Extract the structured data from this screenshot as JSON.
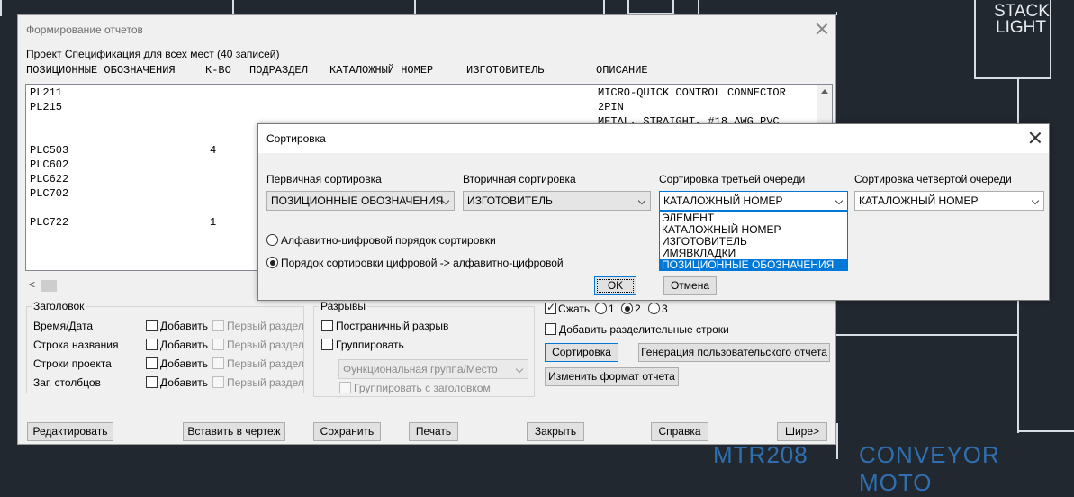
{
  "background": {
    "stack_light_label_line1": "STACK",
    "stack_light_label_line2": "LIGHT",
    "bottom_label_left": "MTR208",
    "bottom_label_right": "CONVEYOR MOTO"
  },
  "report_dialog": {
    "title": "Формирование отчетов",
    "project_label": "Проект Спецификация для всех мест (40 записей)",
    "columns": [
      "ПОЗИЦИОННЫЕ ОБОЗНАЧЕНИЯ",
      "К-ВО",
      "ПОДРАЗДЕЛ",
      "КАТАЛОЖНЫЙ НОМЕР",
      "ИЗГОТОВИТЕЛЬ",
      "ОПИСАНИЕ"
    ],
    "rows": [
      {
        "tag": "PL211",
        "qty": "",
        "desc": "MICRO-QUICK CONTROL CONNECTOR"
      },
      {
        "tag": "PL215",
        "qty": "",
        "desc": "2PIN"
      },
      {
        "tag": "",
        "qty": "",
        "desc": "METAL, STRAIGHT, #18 AWG PVC"
      },
      {
        "tag": "PLC503",
        "qty": "4",
        "desc": ""
      },
      {
        "tag": "PLC602",
        "qty": "",
        "desc": ""
      },
      {
        "tag": "PLC622",
        "qty": "",
        "desc": ""
      },
      {
        "tag": "PLC702",
        "qty": "",
        "desc": ""
      },
      {
        "tag": "PLC722",
        "qty": "1",
        "desc": ""
      }
    ],
    "header_group": {
      "title": "Заголовок",
      "rows": [
        {
          "label": "Время/Дата",
          "add": "Добавить",
          "first": "Первый раздел"
        },
        {
          "label": "Строка названия",
          "add": "Добавить",
          "first": "Первый раздел"
        },
        {
          "label": "Строки проекта",
          "add": "Добавить",
          "first": "Первый раздел"
        },
        {
          "label": "Заг. столбцов",
          "add": "Добавить",
          "first": "Первый раздел"
        }
      ]
    },
    "breaks_group": {
      "title": "Разрывы",
      "page_break": "Постраничный разрыв",
      "group": "Группировать",
      "group_combo": "Функциональная группа/Место",
      "group_with_header": "Группировать с заголовком"
    },
    "compress": {
      "label": "Сжать",
      "options": [
        "1",
        "2",
        "3"
      ],
      "selected": "2"
    },
    "add_separator_lines": "Добавить разделительные строки",
    "sort_button": "Сортировка",
    "custom_report_button": "Генерация пользовательского отчета",
    "change_format_button": "Изменить формат отчета",
    "bottom_buttons": [
      "Редактировать",
      "Вставить в чертеж",
      "Сохранить",
      "Печать",
      "Закрыть",
      "Справка",
      "Шире>"
    ]
  },
  "sort_dialog": {
    "title": "Сортировка",
    "primary_label": "Первичная сортировка",
    "primary_value": "ПОЗИЦИОННЫЕ ОБОЗНАЧЕНИЯ",
    "secondary_label": "Вторичная сортировка",
    "secondary_value": "ИЗГОТОВИТЕЛЬ",
    "third_label": "Сортировка третьей очереди",
    "third_value": "КАТАЛОЖНЫЙ НОМЕР",
    "fourth_label": "Сортировка четвертой очереди",
    "fourth_value": "КАТАЛОЖНЫЙ НОМЕР",
    "dropdown_options": [
      "ЭЛЕМЕНТ",
      "КАТАЛОЖНЫЙ НОМЕР",
      "ИЗГОТОВИТЕЛЬ",
      "ИМЯВКЛАДКИ",
      "ПОЗИЦИОННЫЕ ОБОЗНАЧЕНИЯ"
    ],
    "dropdown_selected": "ПОЗИЦИОННЫЕ ОБОЗНАЧЕНИЯ",
    "radio_alpha": "Алфавитно-цифровой порядок сортировки",
    "radio_numeric": "Порядок сортировки цифровой -> алфавитно-цифровой",
    "radio_selected": "numeric",
    "ok": "OK",
    "cancel": "Отмена"
  },
  "colors": {
    "accent": "#0078d7",
    "cad_bg": "#212830",
    "cad_blue": "#2f6fb0"
  }
}
